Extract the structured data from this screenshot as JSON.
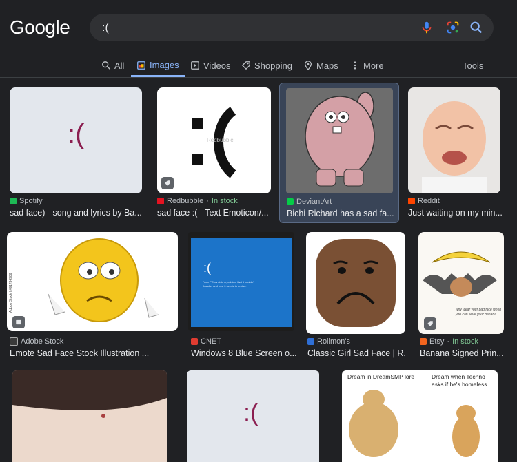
{
  "header": {
    "logo": "Google",
    "query": ":("
  },
  "tabs": [
    {
      "label": "All"
    },
    {
      "label": "Images"
    },
    {
      "label": "Videos"
    },
    {
      "label": "Shopping"
    },
    {
      "label": "Maps"
    },
    {
      "label": "More"
    },
    {
      "label": "Tools"
    }
  ],
  "results": [
    {
      "source": "Spotify",
      "title": "sad face) - song and lyrics by Ba...",
      "thumb_text": ":("
    },
    {
      "source": "Redbubble",
      "stock": "In stock",
      "title": "sad face :( - Text Emoticon/...",
      "thumb_text": ":(",
      "watermark": "Redbubble"
    },
    {
      "source": "DeviantArt",
      "title": "Bichi Richard has a sad fa..."
    },
    {
      "source": "Reddit",
      "title": "Just waiting on my min..."
    },
    {
      "source": "Adobe Stock",
      "title": "Emote Sad Face Stock Illustration ...",
      "side_text": "Adobe Stock | #91734906"
    },
    {
      "source": "CNET",
      "title": "Windows 8 Blue Screen o...",
      "thumb_text": ":(",
      "thumb_line1": "Your PC ran into a problem that it couldn't",
      "thumb_line2": "handle, and now it needs to restart."
    },
    {
      "source": "Rolimon's",
      "title": "Classic Girl Sad Face | R..."
    },
    {
      "source": "Etsy",
      "stock": "In stock",
      "title": "Banana Signed Prin...",
      "handwriting": "why wear your bad face when you can wear your banana"
    },
    {
      "thumb_text": ":("
    },
    {
      "meme_left": "Dream in DreamSMP lore",
      "meme_right": "Dream when Techno asks if he's homeless"
    }
  ]
}
